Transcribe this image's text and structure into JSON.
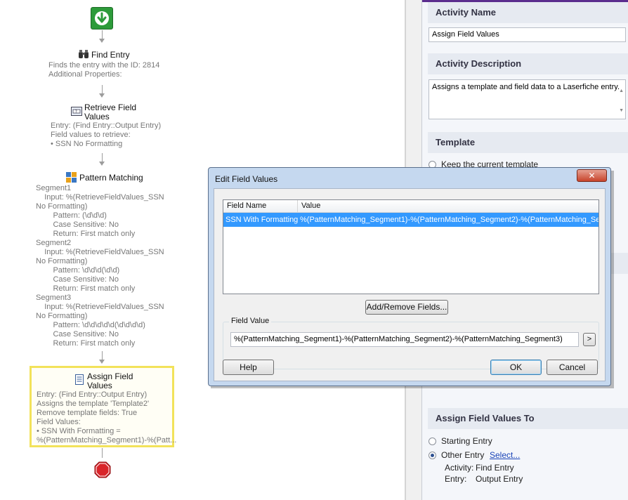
{
  "workflow": {
    "find_entry": {
      "title": "Find Entry",
      "lines": [
        "Finds the entry with the ID: 2814",
        "Additional Properties:"
      ]
    },
    "retrieve": {
      "title_line1": "Retrieve Field",
      "title_line2": "Values",
      "lines": [
        "Entry: (Find Entry::Output Entry)",
        "Field values to retrieve:",
        "• SSN No Formatting"
      ]
    },
    "pattern": {
      "title": "Pattern Matching",
      "lines": [
        "Segment1",
        "    Input: %(RetrieveFieldValues_SSN",
        "No Formatting)",
        "        Pattern: (\\d\\d\\d)",
        "        Case Sensitive: No",
        "        Return: First match only",
        "Segment2",
        "    Input: %(RetrieveFieldValues_SSN",
        "No Formatting)",
        "        Pattern: \\d\\d\\d(\\d\\d)",
        "        Case Sensitive: No",
        "        Return: First match only",
        "Segment3",
        "    Input: %(RetrieveFieldValues_SSN",
        "No Formatting)",
        "        Pattern: \\d\\d\\d\\d\\d(\\d\\d\\d\\d)",
        "        Case Sensitive: No",
        "        Return: First match only"
      ]
    },
    "assign": {
      "title_line1": "Assign Field",
      "title_line2": "Values",
      "lines": [
        "Entry: (Find Entry::Output Entry)",
        "Assigns the template 'Template2'",
        "Remove template fields: True",
        "Field Values:",
        "• SSN With Formatting =",
        "%(PatternMatching_Segment1)-%(Patt..."
      ]
    }
  },
  "properties": {
    "activity_name_header": "Activity Name",
    "activity_name_value": "Assign Field Values",
    "activity_description_header": "Activity Description",
    "activity_description_value": "Assigns a template and field data to a Laserfiche entry.",
    "template_header": "Template",
    "template_option_keep": "Keep the current template",
    "assign_to_header": "Assign Field Values To",
    "starting_entry_label": "Starting Entry",
    "other_entry_label": "Other Entry",
    "select_link": "Select...",
    "activity_label": "Activity:",
    "activity_value": "Find Entry",
    "entry_label": "Entry:",
    "entry_value": "Output Entry",
    "other_entry_selected": true
  },
  "dialog": {
    "title": "Edit Field Values",
    "close_glyph": "✕",
    "columns": [
      "Field Name",
      "Value"
    ],
    "rows": [
      {
        "field": "SSN With Formatting",
        "value": "%(PatternMatching_Segment1)-%(PatternMatching_Segment2)-%(PatternMatching_Seg..."
      }
    ],
    "add_remove_label": "Add/Remove Fields...",
    "field_value_group": "Field Value",
    "field_value_input": "%(PatternMatching_Segment1)-%(PatternMatching_Segment2)-%(PatternMatching_Segment3)",
    "token_button": ">",
    "help_label": "Help",
    "ok_label": "OK",
    "cancel_label": "Cancel"
  },
  "colors": {
    "start_green": "#2d9b3a",
    "selection_yellow": "#f2e25a",
    "stop_red": "#d9252a",
    "row_highlight": "#3399ff",
    "header_purple": "#5b2d8e"
  }
}
